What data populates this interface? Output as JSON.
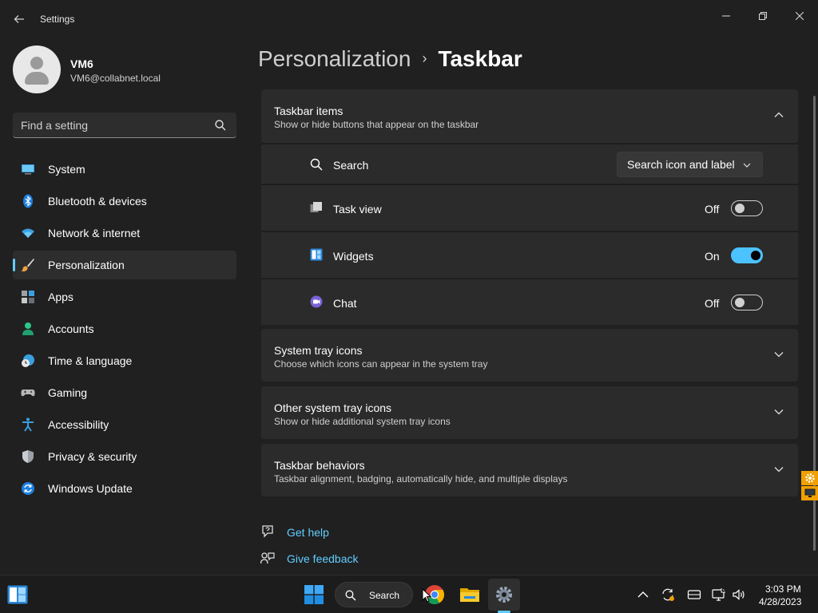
{
  "window": {
    "title": "Settings"
  },
  "profile": {
    "name": "VM6",
    "email": "VM6@collabnet.local"
  },
  "search": {
    "placeholder": "Find a setting"
  },
  "sidebar": {
    "items": [
      {
        "label": "System",
        "icon": "system-icon"
      },
      {
        "label": "Bluetooth & devices",
        "icon": "bluetooth-icon"
      },
      {
        "label": "Network & internet",
        "icon": "wifi-icon"
      },
      {
        "label": "Personalization",
        "icon": "brush-icon",
        "active": true
      },
      {
        "label": "Apps",
        "icon": "apps-icon"
      },
      {
        "label": "Accounts",
        "icon": "accounts-icon"
      },
      {
        "label": "Time & language",
        "icon": "clock-globe-icon"
      },
      {
        "label": "Gaming",
        "icon": "gamepad-icon"
      },
      {
        "label": "Accessibility",
        "icon": "accessibility-icon"
      },
      {
        "label": "Privacy & security",
        "icon": "shield-icon"
      },
      {
        "label": "Windows Update",
        "icon": "update-icon"
      }
    ]
  },
  "breadcrumb": {
    "parent": "Personalization",
    "separator": "›",
    "current": "Taskbar"
  },
  "sections": {
    "taskbar_items": {
      "title": "Taskbar items",
      "subtitle": "Show or hide buttons that appear on the taskbar",
      "expanded": true
    },
    "system_tray_icons": {
      "title": "System tray icons",
      "subtitle": "Choose which icons can appear in the system tray"
    },
    "other_tray_icons": {
      "title": "Other system tray icons",
      "subtitle": "Show or hide additional system tray icons"
    },
    "behaviors": {
      "title": "Taskbar behaviors",
      "subtitle": "Taskbar alignment, badging, automatically hide, and multiple displays"
    }
  },
  "taskbar_items": {
    "search": {
      "label": "Search",
      "value": "Search icon and label"
    },
    "task_view": {
      "label": "Task view",
      "state": "Off"
    },
    "widgets": {
      "label": "Widgets",
      "state": "On"
    },
    "chat": {
      "label": "Chat",
      "state": "Off"
    }
  },
  "help": {
    "get_help": "Get help",
    "give_feedback": "Give feedback"
  },
  "taskbar": {
    "search_label": "Search",
    "time": "3:03 PM",
    "date": "4/28/2023"
  },
  "colors": {
    "accent": "#60cdff",
    "toggle_on": "#4cc2ff",
    "background": "#202020",
    "card": "#2b2b2b"
  }
}
